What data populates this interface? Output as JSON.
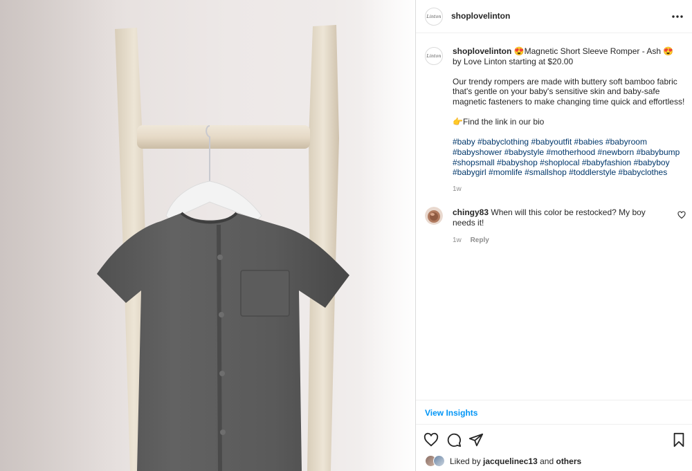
{
  "post": {
    "image_alt": "Gray short sleeve baby romper on a white hanger hanging on a wooden ladder",
    "header": {
      "username": "shoplovelinton",
      "more_icon": "more-horizontal-icon"
    },
    "caption": {
      "username": "shoplovelinton",
      "line1": "😍Magnetic Short Sleeve Romper - Ash 😍",
      "line2": "by Love Linton starting at $20.00",
      "para1": "Our trendy rompers are made with buttery soft bamboo fabric that's gentle on your baby's sensitive skin and baby-safe magnetic fasteners to make changing time quick and effortless!",
      "para2": "👉Find the link in our bio",
      "hashtags": [
        "#baby",
        "#babyclothing",
        "#babyoutfit",
        "#babies",
        "#babyroom",
        "#babyshower",
        "#babystyle",
        "#motherhood",
        "#newborn",
        "#babybump",
        "#shopsmall",
        "#babyshop",
        "#shoplocal",
        "#babyfashion",
        "#babyboy",
        "#babygirl",
        "#momlife",
        "#smallshop",
        "#toddlerstyle",
        "#babyclothes"
      ],
      "time": "1w"
    },
    "comments": [
      {
        "username": "chingy83",
        "text": "When will this color be restocked? My boy needs it!",
        "time": "1w",
        "reply_label": "Reply"
      }
    ],
    "insights_label": "View Insights",
    "actions": {
      "like_icon": "heart-icon",
      "comment_icon": "comment-icon",
      "share_icon": "send-icon",
      "save_icon": "bookmark-icon"
    },
    "likes": {
      "prefix": "Liked by",
      "user": "jacquelinec13",
      "and_label": "and",
      "others_label": "others"
    }
  },
  "colors": {
    "link": "#0095f6",
    "hashtag": "#00376b",
    "muted": "#8e8e8e",
    "text": "#262626"
  }
}
